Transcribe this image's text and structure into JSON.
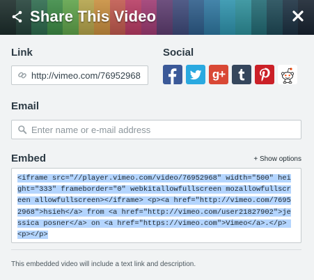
{
  "header": {
    "title": "Share This Video",
    "stripe_colors": [
      "#1c2d2b",
      "#24423a",
      "#2d6a4d",
      "#3c8a45",
      "#5fa34a",
      "#b3a34a",
      "#c88e3e",
      "#c0594e",
      "#b73b63",
      "#9e3a72",
      "#5e3d70",
      "#3e4a7a",
      "#2e5d8a",
      "#2f77a0",
      "#2f93ad",
      "#2e8f9a",
      "#226a73",
      "#1f4a57",
      "#1c3142",
      "#182330"
    ],
    "share_icon": "share-icon",
    "close_icon": "close-icon"
  },
  "link": {
    "label": "Link",
    "value": "http://vimeo.com/76952968",
    "icon": "link-icon"
  },
  "social": {
    "label": "Social",
    "items": [
      {
        "name": "facebook",
        "glyph": "f",
        "color": "#3b5998"
      },
      {
        "name": "twitter",
        "glyph": "t",
        "color": "#2aa9e0"
      },
      {
        "name": "google-plus",
        "glyph": "g+",
        "color": "#d94835"
      },
      {
        "name": "tumblr",
        "glyph": "t",
        "color": "#35465c"
      },
      {
        "name": "pinterest",
        "glyph": "p",
        "color": "#cb2027"
      },
      {
        "name": "reddit",
        "glyph": "reddit-alien",
        "color": "#ffffff"
      }
    ]
  },
  "email": {
    "label": "Email",
    "placeholder": "Enter name or e-mail address",
    "icon": "search-icon"
  },
  "embed": {
    "label": "Embed",
    "show_options": "+ Show options",
    "code": "<iframe src=\"//player.vimeo.com/video/76952968\" width=\"500\" height=\"333\" frameborder=\"0\" webkitallowfullscreen mozallowfullscreen allowfullscreen></iframe> <p><a href=\"http://vimeo.com/76952968\">hsieh</a> from <a href=\"http://vimeo.com/user21827902\">jessica posner</a> on <a href=\"https://vimeo.com\">Vimeo</a>.</p> <p></p>",
    "selection_color": "#b4d5fe"
  },
  "footnote": "This embedded video will include a text link and description."
}
